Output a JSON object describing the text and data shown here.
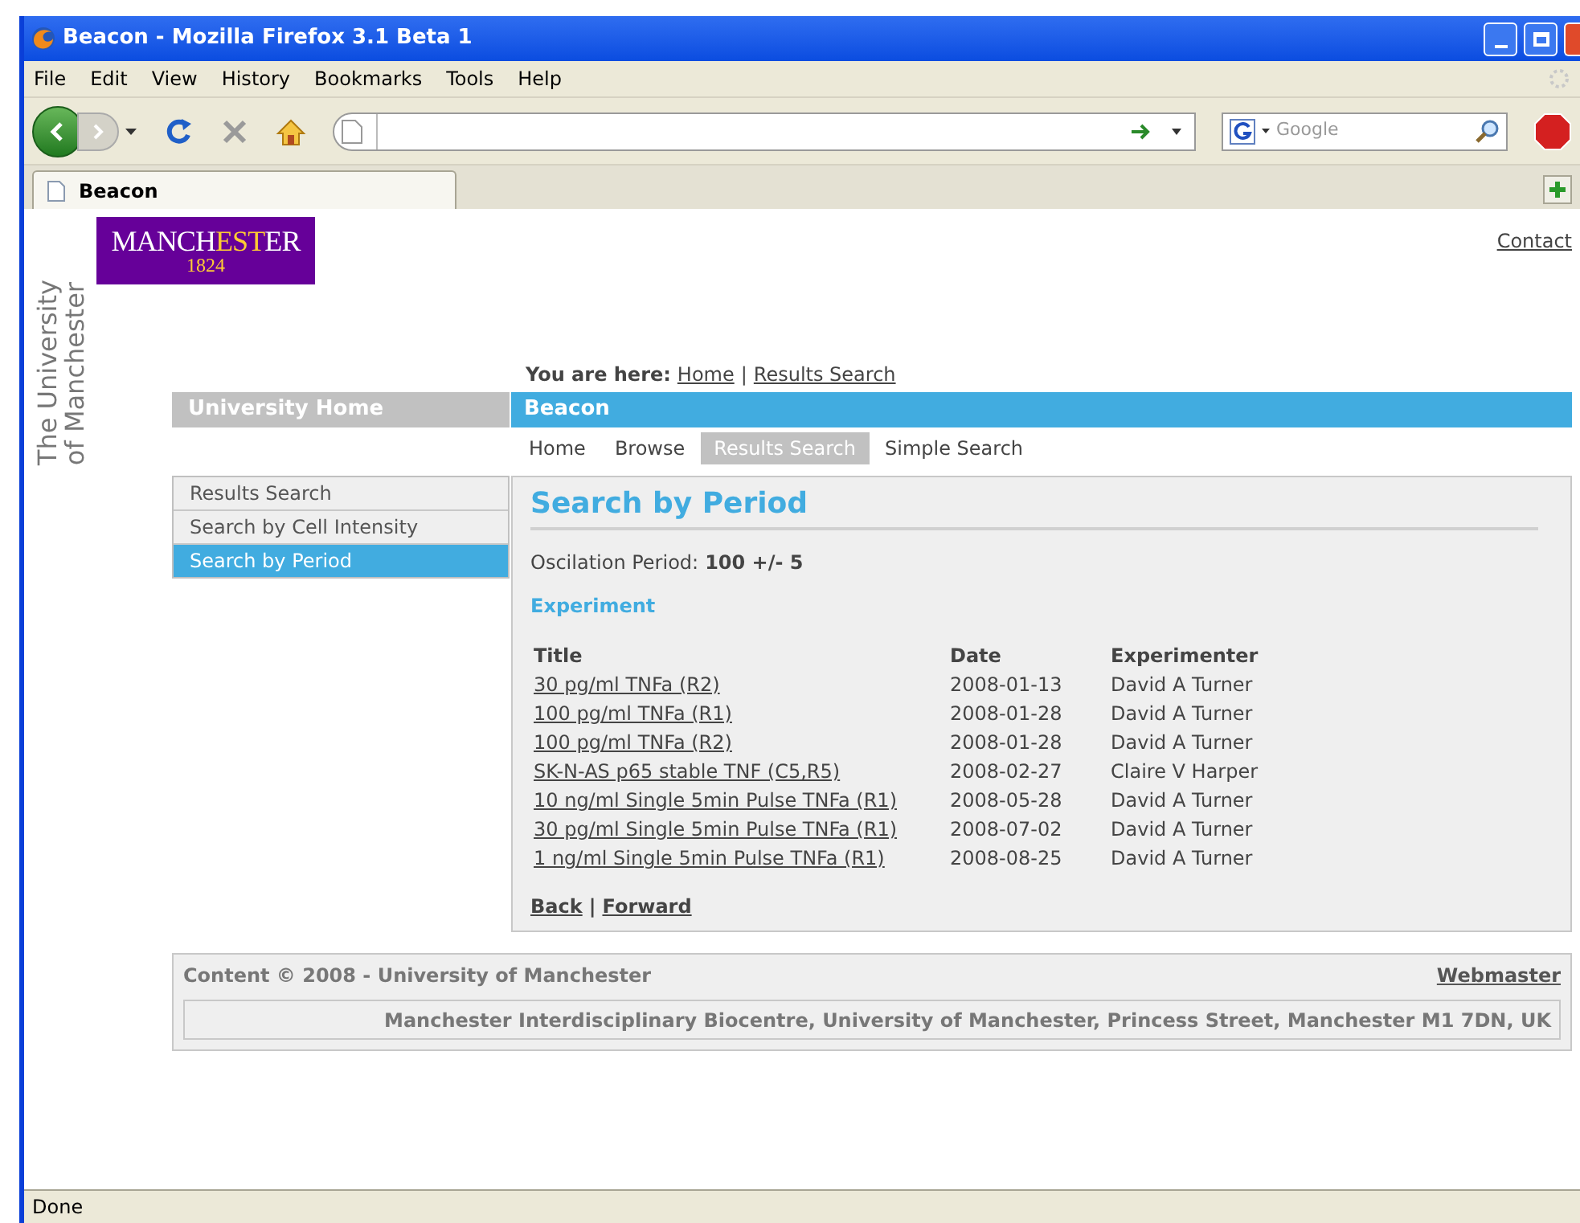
{
  "window": {
    "title": "Beacon - Mozilla Firefox 3.1 Beta 1"
  },
  "menu": [
    {
      "label": "File"
    },
    {
      "label": "Edit"
    },
    {
      "label": "View"
    },
    {
      "label": "History"
    },
    {
      "label": "Bookmarks"
    },
    {
      "label": "Tools"
    },
    {
      "label": "Help"
    }
  ],
  "search_box": {
    "placeholder": "Google"
  },
  "tabs": [
    {
      "label": "Beacon",
      "selected": true
    }
  ],
  "page": {
    "side_text": [
      "The University",
      "of Manchester"
    ],
    "logo": {
      "before": "MANCH",
      "highlight": "EST",
      "after": "ER",
      "year": "1824"
    },
    "contact": "Contact",
    "breadcrumb": {
      "label": "You are here:",
      "links": [
        "Home",
        "Results Search"
      ],
      "separator": "|"
    },
    "left_header": "University Home",
    "right_header": "Beacon",
    "nav": [
      {
        "label": "Home",
        "selected": false
      },
      {
        "label": "Browse",
        "selected": false
      },
      {
        "label": "Results Search",
        "selected": true
      },
      {
        "label": "Simple Search",
        "selected": false
      }
    ],
    "side_menu": [
      {
        "label": "Results Search",
        "selected": false
      },
      {
        "label": "Search by Cell Intensity",
        "selected": false
      },
      {
        "label": "Search by Period",
        "selected": true
      }
    ],
    "heading": "Search by Period",
    "period": {
      "label": "Oscilation Period:",
      "value": "100 +/- 5"
    },
    "section": "Experiment",
    "table": {
      "columns": [
        "Title",
        "Date",
        "Experimenter"
      ],
      "rows": [
        [
          "30 pg/ml TNFa (R2)",
          "2008-01-13",
          "David A Turner"
        ],
        [
          "100 pg/ml TNFa (R1)",
          "2008-01-28",
          "David A Turner"
        ],
        [
          "100 pg/ml TNFa (R2)",
          "2008-01-28",
          "David A Turner"
        ],
        [
          "SK-N-AS p65 stable TNF (C5,R5)",
          "2008-02-27",
          "Claire V Harper"
        ],
        [
          "10 ng/ml Single 5min Pulse TNFa (R1)",
          "2008-05-28",
          "David A Turner"
        ],
        [
          "30 pg/ml Single 5min Pulse TNFa (R1)",
          "2008-07-02",
          "David A Turner"
        ],
        [
          "1 ng/ml Single 5min Pulse TNFa (R1)",
          "2008-08-25",
          "David A Turner"
        ]
      ]
    },
    "pager": {
      "back": "Back",
      "separator": "|",
      "forward": "Forward"
    },
    "footer": {
      "copyright": "Content © 2008 - University of Manchester",
      "webmaster": "Webmaster",
      "address": "Manchester Interdisciplinary Biocentre, University of Manchester, Princess Street, Manchester M1 7DN, UK"
    }
  },
  "status_bar": {
    "text": "Done"
  }
}
